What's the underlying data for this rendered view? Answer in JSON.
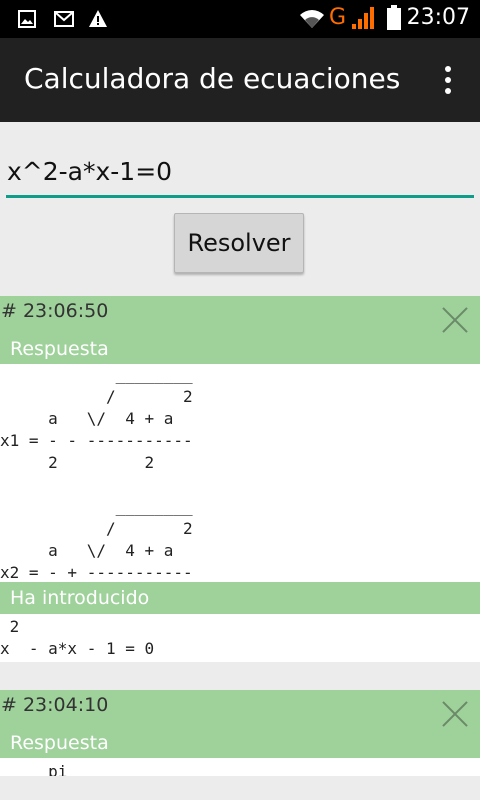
{
  "status": {
    "time": "23:07",
    "network": "G",
    "icons": [
      "gallery-icon",
      "mail-icon",
      "warning-icon",
      "wifi-icon",
      "signal-icon",
      "battery-icon"
    ]
  },
  "app": {
    "title": "Calculadora de ecuaciones",
    "menu_icon": "overflow-menu-icon"
  },
  "input": {
    "value": "x^2-a*x-1=0"
  },
  "solve_label": "Resolver",
  "accent_color": "#0f9d8a",
  "card_color": "#9fd19b",
  "results": [
    {
      "timestamp": "# 23:06:50",
      "answer_label": "Respuesta",
      "answer_text": "            ________\n           /       2\n     a   \\/  4 + a\nx1 = - - -----------\n     2         2\n\n            ________\n           /       2\n     a   \\/  4 + a\nx2 = - + -----------\n     2         2",
      "input_label": "Ha introducido",
      "input_text": " 2\nx  - a*x - 1 = 0"
    },
    {
      "timestamp": "# 23:04:10",
      "answer_label": "Respuesta",
      "answer_text": "     pi"
    }
  ]
}
